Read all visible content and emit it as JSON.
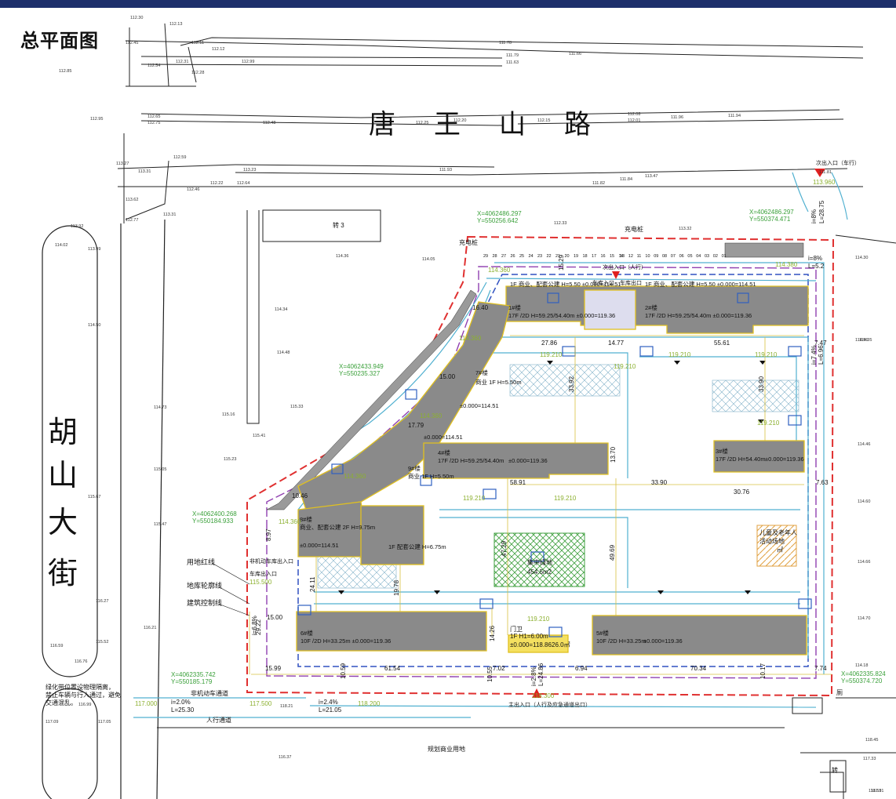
{
  "page_title": "总平面图",
  "roads": {
    "north": [
      "唐",
      "王",
      "山",
      "路"
    ],
    "west": [
      "胡",
      "山",
      "大",
      "街"
    ]
  },
  "coords": [
    {
      "x": "X=4062486.297",
      "y": "Y=550256.642"
    },
    {
      "x": "X=4062486.297",
      "y": "Y=550374.471"
    },
    {
      "x": "X=4062433.949",
      "y": "Y=550235.327"
    },
    {
      "x": "X=4062400.268",
      "y": "Y=550184.933"
    },
    {
      "x": "X=4062335.742",
      "y": "Y=550185.179"
    },
    {
      "x": "X=4062335.824",
      "y": "Y=550374.720"
    }
  ],
  "legend": [
    "用地红线",
    "地库轮廓线",
    "建筑控制线"
  ],
  "buildings": [
    {
      "no": "1#楼",
      "info": "17F /2D H=59.25/54.40m ±0.000=119.36",
      "extra": "1F 商业、配套公建 H=5.50  ±0.000=114.51"
    },
    {
      "no": "2#楼",
      "info": "17F /2D H=59.25/54.40m ±0.000=119.36",
      "extra": "1F 商业、配套公建 H=5.50  ±0.000=114.51"
    },
    {
      "no": "3#楼",
      "info": "17F /2D H=54.40m",
      "extra": "±0.000=119.36"
    },
    {
      "no": "4#楼",
      "info": "17F /2D H=59.25/54.40m",
      "extra": "±0.000=119.36"
    },
    {
      "no": "5#楼",
      "info": "10F /2D H=33.25m",
      "extra": "±0.000=119.36"
    },
    {
      "no": "6#楼",
      "info": "10F /2D H=33.25m ±0.000=119.36",
      "extra": ""
    },
    {
      "no": "7#楼",
      "info": "商业 1F H=5.50m",
      "extra": "±0.000=114.51"
    },
    {
      "no": "8#楼",
      "info": "商业、配套公建 2F H=9.75m",
      "extra": "±0.000=114.51"
    },
    {
      "no": "9#楼",
      "info": "商业 1F H=5.50m",
      "extra": "±0.000=114.51"
    },
    {
      "no": "1#楼",
      "info": "1F 配套公建 H=6.75m",
      "extra": ""
    }
  ],
  "guard": {
    "name": "门卫",
    "info": "1F H1=6.00m",
    "level": "±0.000=118.86",
    "area": "26.0㎡"
  },
  "square": {
    "label": "集中绿地",
    "area": "454.5m2"
  },
  "kids_area": [
    "儿童及老年人",
    "活动场地",
    "㎡"
  ],
  "entrances": {
    "main": "主出入口（人行及应急通道出口）",
    "secondary": "次出入口（人行）",
    "garage_in": "车库入口",
    "garage_out": "车库出口",
    "nonmotor": "非机动车库出入口",
    "garage_io": "车库出入口",
    "north_car": "次出入口（车行）"
  },
  "dims": {
    "top": [
      "27.86",
      "14.77",
      "55.61",
      "15.29",
      "7.47"
    ],
    "mid": [
      "58.91",
      "13.70",
      "33.90",
      "30.76",
      "7.63"
    ],
    "vert": [
      "33.92",
      "33.90",
      "47.29",
      "49.69",
      "19.78",
      "24.11"
    ],
    "bottom": [
      "15.99",
      "10.59",
      "61.54",
      "10.55",
      "7.02",
      "6.94",
      "70.34",
      "10.17",
      "7.74",
      "14.26"
    ],
    "misc": [
      "16.40",
      "15.00",
      "17.79",
      "10.46",
      "8.97",
      "15.00",
      "29.22"
    ]
  },
  "slopes": [
    "i=2.0%",
    "L=25.30",
    "i=2.4%",
    "L=21.05",
    "i=8%",
    "L=28.75",
    "i=2.8%",
    "L=24.86",
    "i=8%",
    "L=5.2",
    "i=6.8%",
    "i=7.4%",
    "L=6.96"
  ],
  "levels": [
    "114.360",
    "114.360",
    "114.360",
    "114.360",
    "114.360",
    "119.210",
    "119.210",
    "119.210",
    "119.210",
    "119.210",
    "119.210",
    "119.210",
    "119.210",
    "117.000",
    "117.500",
    "118.200",
    "113.960",
    "118.300",
    "115.500",
    "114.380"
  ],
  "numbers_row": [
    "29",
    "28",
    "27",
    "26",
    "25",
    "24",
    "23",
    "22",
    "21",
    "20",
    "19",
    "18",
    "17",
    "16",
    "15",
    "14",
    "13",
    "12",
    "11",
    "10",
    "09",
    "08",
    "07",
    "06",
    "05",
    "04",
    "03",
    "02",
    "01"
  ],
  "labels": {
    "commercial": "规划商业用地",
    "trans": "转 3",
    "trans2": "转",
    "landscape": "绿化带位置设物理隔离，禁止车辆与行人通过，避免交通混乱。",
    "charger": "充电桩",
    "nonmotor_lane": "非机动车通道",
    "ped_lane": "人行通道",
    "hall": "厕"
  },
  "spot_heights": [
    "112.30",
    "112.13",
    "112.11",
    "112.12",
    "111.78",
    "111.79",
    "111.63",
    "111.66",
    "112.45",
    "112.54",
    "112.31",
    "112.28",
    "112.85",
    "112.99",
    "112.95",
    "112.65",
    "112.75",
    "112.48",
    "112.25",
    "112.20",
    "112.15",
    "112.08",
    "112.01",
    "111.96",
    "111.94",
    "113.27",
    "113.31",
    "112.59",
    "113.23",
    "111.93",
    "111.82",
    "111.81",
    "111.84",
    "113.47",
    "113.62",
    "112.77",
    "112.46",
    "112.22",
    "112.64",
    "112.33",
    "113.32",
    "113.31",
    "113.92",
    "114.02",
    "113.99",
    "114.36",
    "114.05",
    "114.34",
    "114.50",
    "114.48",
    "114.56",
    "114.73",
    "115.16",
    "115.23",
    "115.33",
    "115.41",
    "115.67",
    "115.05",
    "115.47",
    "116.27",
    "115.52",
    "116.21",
    "116.59",
    "116.76",
    "117.09",
    "117.05",
    "116.99",
    "116.37",
    "118.21",
    "118.45",
    "118.59",
    "117.33",
    "117.31",
    "114.30",
    "114.35",
    "114.46",
    "114.60",
    "114.66",
    "114.70",
    "114.18"
  ]
}
